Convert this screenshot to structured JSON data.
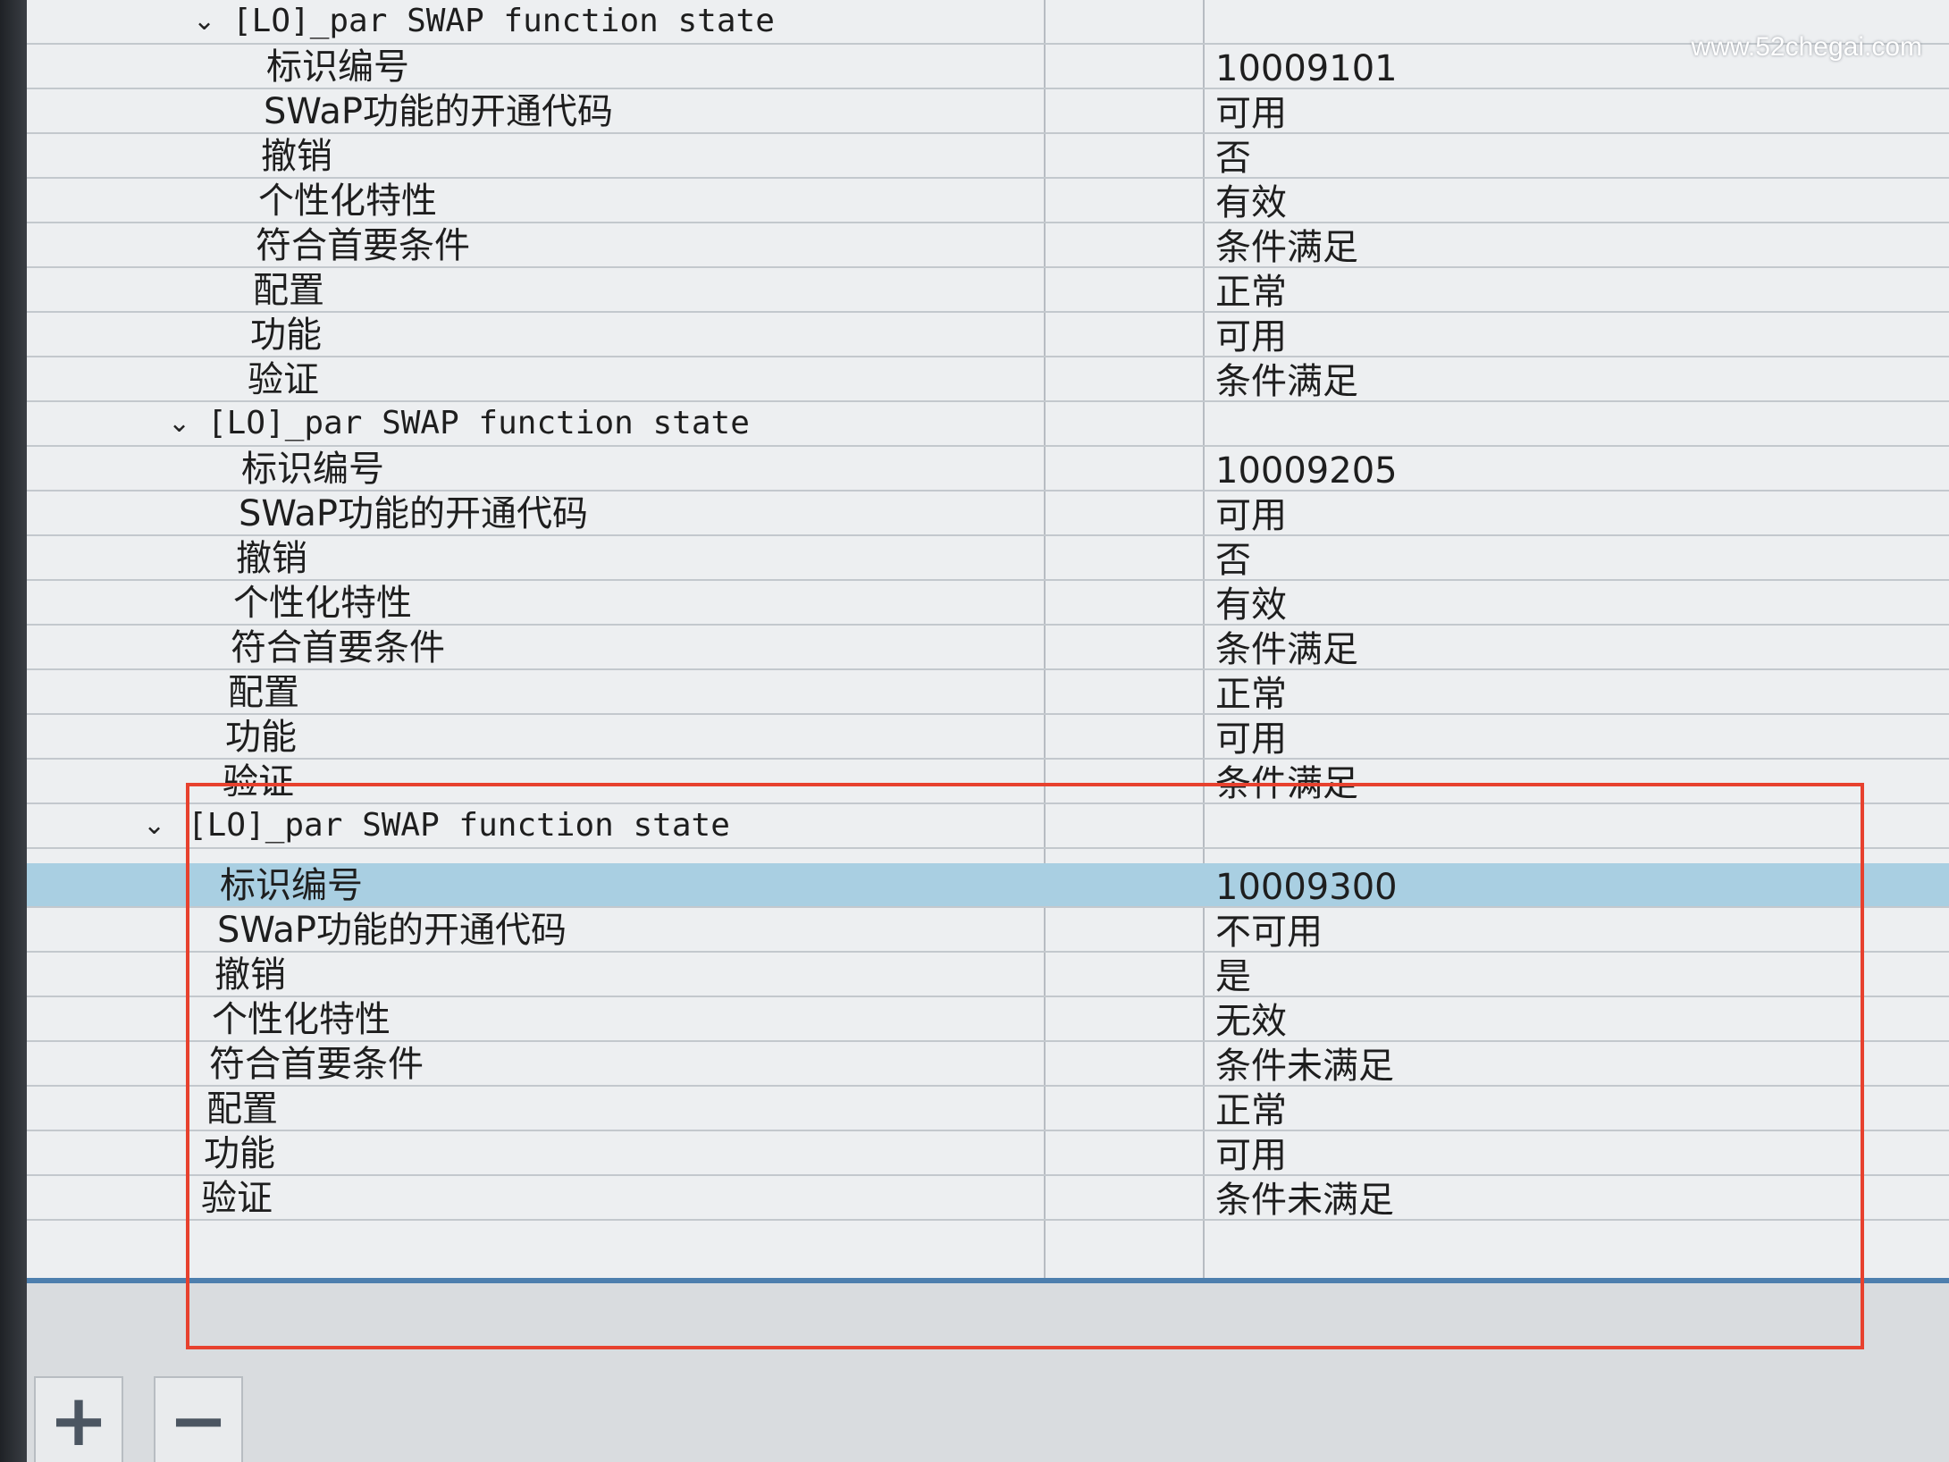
{
  "watermark": "www.52chegai.com",
  "groups": [
    {
      "title": "[LO]_par SWAP function state",
      "properties": [
        {
          "label": "标识编号",
          "value": "10009101"
        },
        {
          "label": "SWaP功能的开通代码",
          "value": "可用"
        },
        {
          "label": "撤销",
          "value": "否"
        },
        {
          "label": "个性化特性",
          "value": "有效"
        },
        {
          "label": "符合首要条件",
          "value": "条件满足"
        },
        {
          "label": "配置",
          "value": "正常"
        },
        {
          "label": "功能",
          "value": "可用"
        },
        {
          "label": "验证",
          "value": "条件满足"
        }
      ]
    },
    {
      "title": "[LO]_par SWAP function state",
      "properties": [
        {
          "label": "标识编号",
          "value": "10009205"
        },
        {
          "label": "SWaP功能的开通代码",
          "value": "可用"
        },
        {
          "label": "撤销",
          "value": "否"
        },
        {
          "label": "个性化特性",
          "value": "有效"
        },
        {
          "label": "符合首要条件",
          "value": "条件满足"
        },
        {
          "label": "配置",
          "value": "正常"
        },
        {
          "label": "功能",
          "value": "可用"
        },
        {
          "label": "验证",
          "value": "条件满足"
        }
      ]
    },
    {
      "title": "[LO]_par SWAP function state",
      "properties": [
        {
          "label": "标识编号",
          "value": "10009300"
        },
        {
          "label": "SWaP功能的开通代码",
          "value": "不可用"
        },
        {
          "label": "撤销",
          "value": "是"
        },
        {
          "label": "个性化特性",
          "value": "无效"
        },
        {
          "label": "符合首要条件",
          "value": "条件未满足"
        },
        {
          "label": "配置",
          "value": "正常"
        },
        {
          "label": "功能",
          "value": "可用"
        },
        {
          "label": "验证",
          "value": "条件未满足"
        }
      ]
    }
  ],
  "selected": {
    "group": 3,
    "row": 1
  },
  "toolbar": {
    "add_label": "+",
    "remove_label": "−"
  },
  "icons": {
    "expand": "chevron-down-icon",
    "add": "plus-icon",
    "remove": "minus-icon"
  },
  "colors": {
    "selection": "#a9cfe2",
    "highlight_box": "#e7412e",
    "panel_border": "#4d7fae"
  }
}
